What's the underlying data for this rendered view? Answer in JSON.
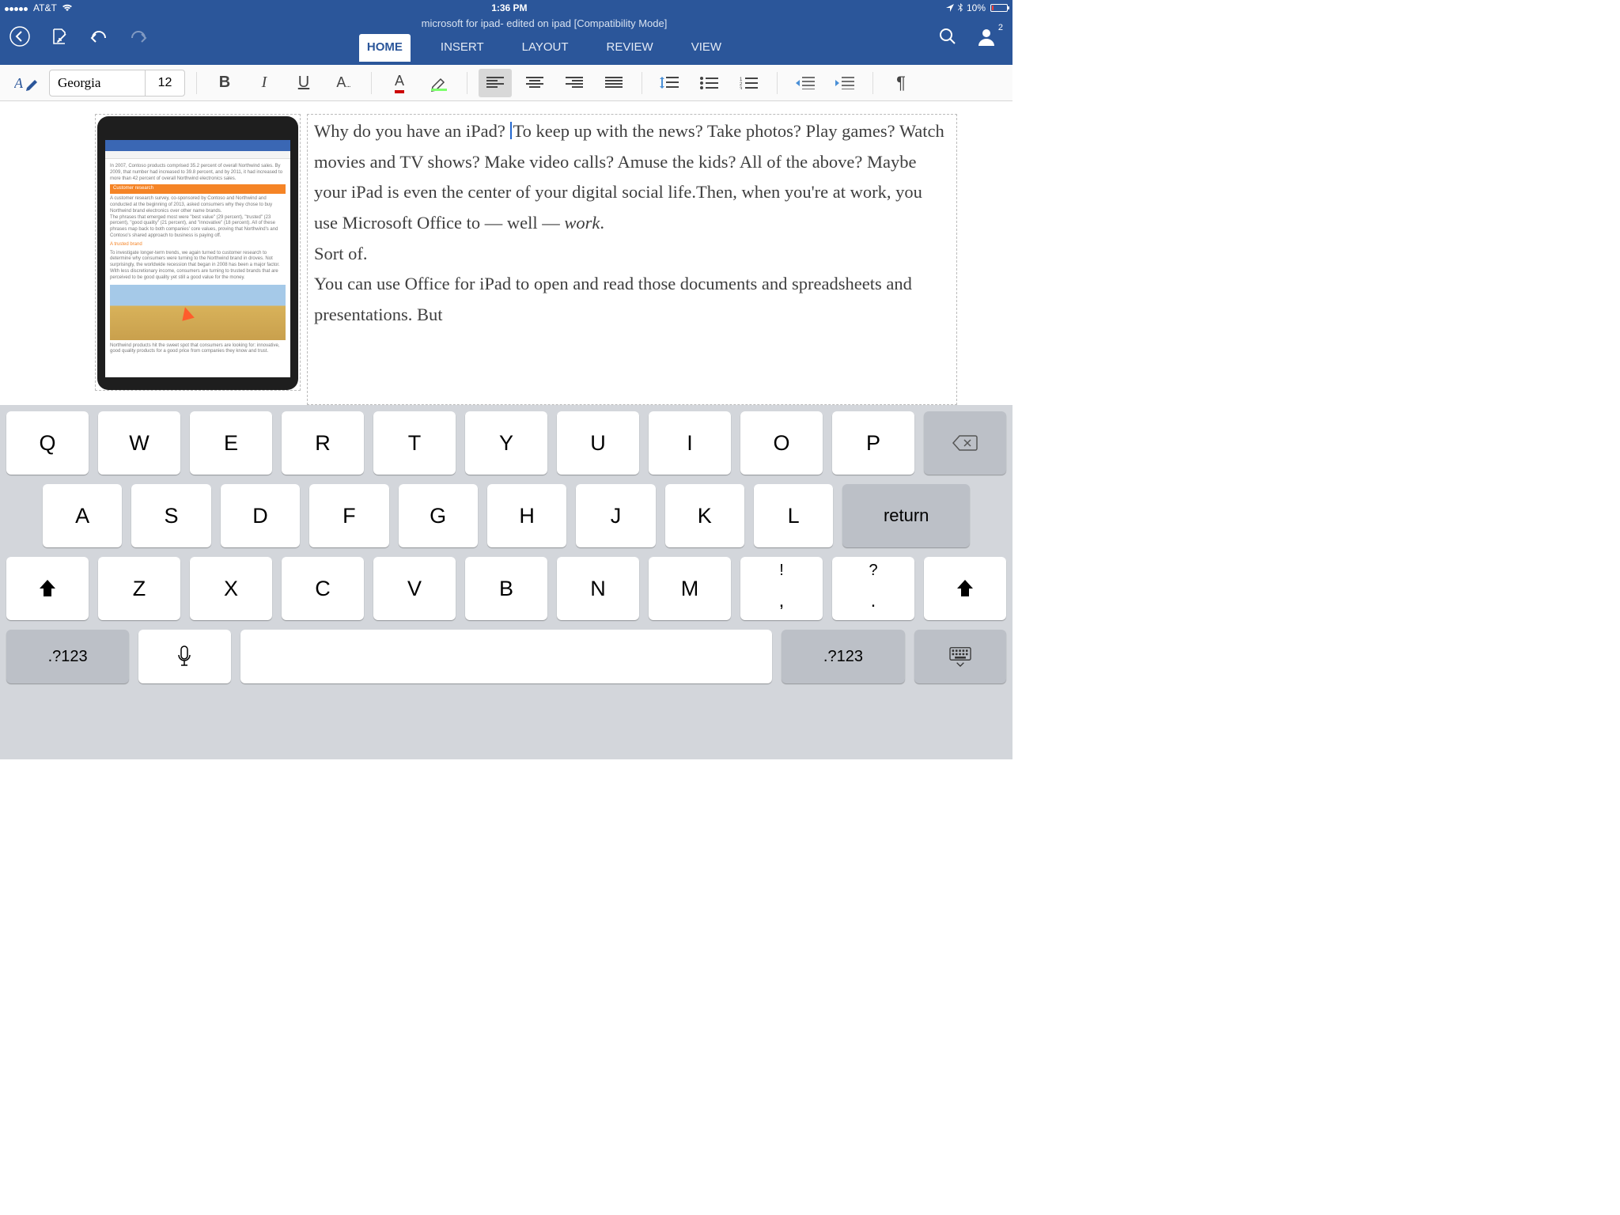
{
  "status": {
    "carrier": "AT&T",
    "time": "1:36 PM",
    "battery_pct": "10%"
  },
  "header": {
    "doc_title": "microsoft for ipad- edited on ipad [Compatibility Mode]",
    "account_badge": "2"
  },
  "tabs": {
    "home": "HOME",
    "insert": "INSERT",
    "layout": "LAYOUT",
    "review": "REVIEW",
    "view": "VIEW"
  },
  "toolbar": {
    "font_name": "Georgia",
    "font_size": "12"
  },
  "document": {
    "p1a": "Why do you have an iPad? ",
    "p1b": "To keep up with the news? Take photos? Play games? Watch movies and TV shows? Make video calls? Amuse the kids? All of the above? Maybe your iPad is even the center of your digital social life.Then, when you're at work, you use Microsoft Office to — well — ",
    "p1_em": "work",
    "p1c": ".",
    "p2": "Sort of.",
    "p3": "You can use Office for iPad to open and read those documents and spreadsheets and presentations. But",
    "mock": {
      "line1": "In 2007, Contoso products comprised 35.2 percent of overall Northwind sales. By 2009, that number had increased to 39.8 percent, and by 2011, it had increased to more than 42 percent of overall Northwind electronics sales.",
      "orange_bar": "Customer research",
      "line2": "A customer research survey, co-sponsored by Contoso and Northwind and conducted at the beginning of 2013, asked consumers why they chose to buy Northwind brand electronics over other name brands.",
      "line3": "The phrases that emerged most were \"best value\" (29 percent), \"trusted\" (23 percent), \"good quality\" (21 percent), and \"innovative\" (18 percent). All of these phrases map back to both companies' core values, proving that Northwind's and Contoso's shared approach to business is paying off.",
      "orange_txt": "A trusted brand",
      "line4": "To investigate longer-term trends, we again turned to customer research to determine why consumers were turning to the Northwind brand in droves. Not surprisingly, the worldwide recession that began in 2008 has been a major factor. With less discretionary income, consumers are turning to trusted brands that are perceived to be good quality yet still a good value for the money.",
      "line5": "Northwind products hit the sweet spot that consumers are looking for: innovative, good quality products for a good price from companies they know and trust."
    }
  },
  "keyboard": {
    "row1": [
      "Q",
      "W",
      "E",
      "R",
      "T",
      "Y",
      "U",
      "I",
      "O",
      "P"
    ],
    "row2": [
      "A",
      "S",
      "D",
      "F",
      "G",
      "H",
      "J",
      "K",
      "L"
    ],
    "row3": [
      "Z",
      "X",
      "C",
      "V",
      "B",
      "N",
      "M"
    ],
    "punct1_top": "!",
    "punct1_bot": ",",
    "punct2_top": "?",
    "punct2_bot": ".",
    "return": "return",
    "numkey": ".?123"
  }
}
